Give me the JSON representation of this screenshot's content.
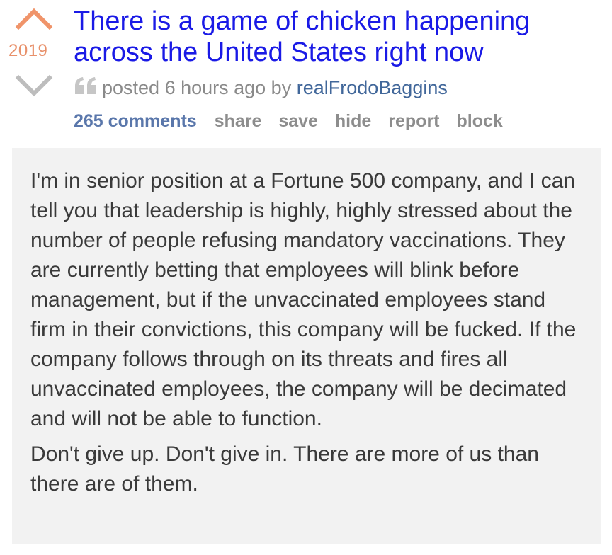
{
  "post": {
    "score": "2019",
    "title": "There is a game of chicken happening across the United States right now",
    "tagline": {
      "posted_text": "posted 6 hours ago by",
      "author": "realFrodoBaggins"
    },
    "actions": {
      "comments": "265 comments",
      "share": "share",
      "save": "save",
      "hide": "hide",
      "report": "report",
      "block": "block"
    },
    "body": {
      "paragraph_1": "I'm in senior position at a Fortune 500 company, and I can tell you that leadership is highly, highly stressed about the number of people refusing mandatory vaccinations. They are currently betting that employees will blink before management, but if the unvaccinated employees stand firm in their convictions, this company will be fucked. If the company follows through on its threats and fires all unvaccinated employees, the company will be decimated and will not be able to function.",
      "paragraph_2": "Don't give up. Don't give in. There are more of us than there are of them."
    }
  },
  "colors": {
    "upvote_arrow": "#f0946a",
    "downvote_arrow": "#bdbdbd",
    "title": "#1a1ae6",
    "author": "#41679a",
    "comments_link": "#5a77ab",
    "body_background": "#f2f2f2"
  },
  "icons": {
    "upvote": "upvote-arrow-icon",
    "downvote": "downvote-arrow-icon",
    "quote": "quote-icon"
  }
}
